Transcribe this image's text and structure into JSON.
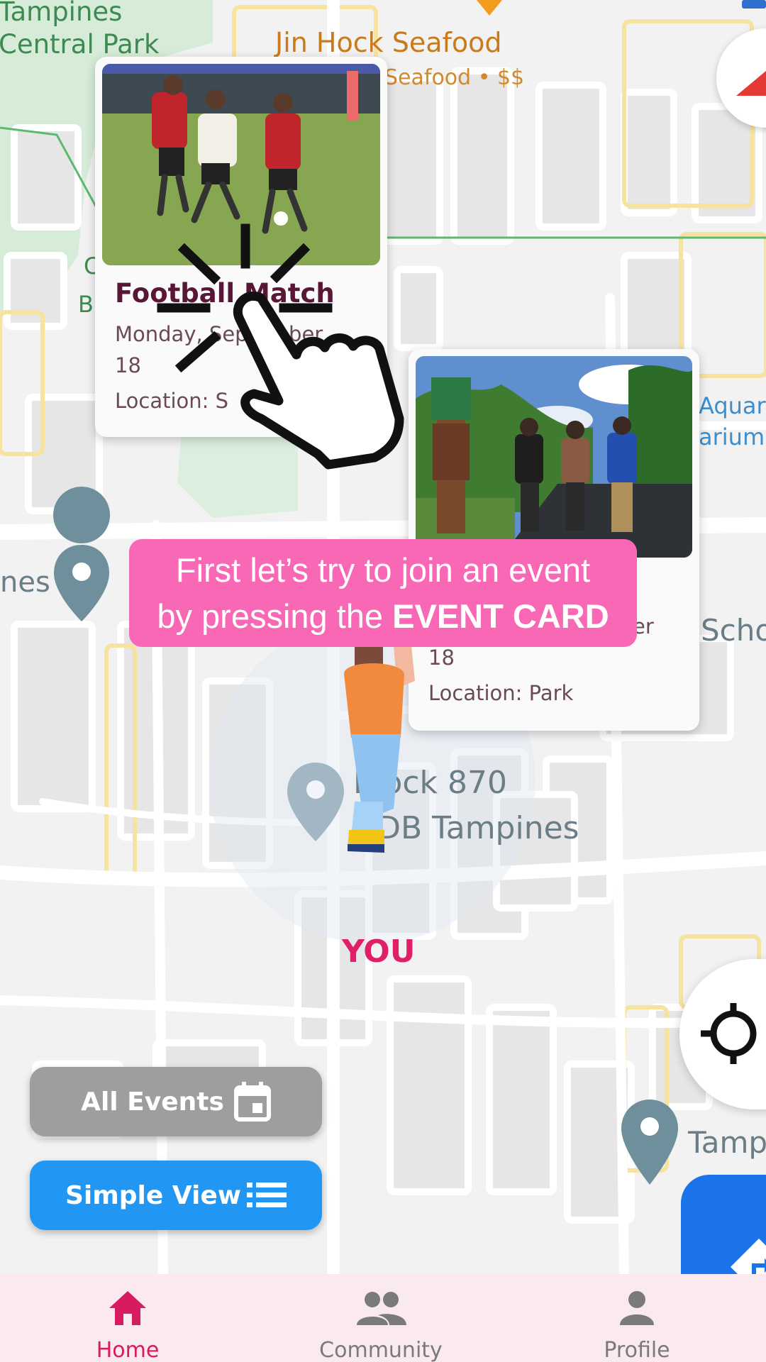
{
  "map": {
    "poi_tampines_park": "Tampines\nCentral Park",
    "poi_restaurant": "Jin Hock Seafood",
    "poi_restaurant_sub": "Seafood • $$",
    "poi_block": "Block 870\nHDB Tampines",
    "poi_aquarium": "Aquar\narium",
    "poi_school": "Scho",
    "poi_left": "nes",
    "poi_right_bottom": "Tamp",
    "poi_b": "B",
    "poi_c": "C",
    "you_label": "YOU",
    "you_color": "#e01f68"
  },
  "events": [
    {
      "title": "Football Match",
      "date": "Monday, September",
      "day": "18",
      "location": "Location: S"
    },
    {
      "title": "",
      "date": "er",
      "day": "18",
      "location": "Location: Park"
    }
  ],
  "tutorial": {
    "line1": "First let’s try to join an event",
    "line2_prefix": "by pressing the ",
    "line2_bold": "EVENT CARD",
    "bg_color": "#f968b5"
  },
  "buttons": {
    "all_events": "All Events",
    "simple_view": "Simple View",
    "all_events_icon": "calendar-icon",
    "simple_view_icon": "list-icon",
    "simple_view_color": "#2196f3",
    "all_events_color": "#9e9e9e"
  },
  "nav": {
    "items": [
      {
        "label": "Home",
        "icon": "home-icon",
        "active": true
      },
      {
        "label": "Community",
        "icon": "people-icon",
        "active": false
      },
      {
        "label": "Profile",
        "icon": "person-icon",
        "active": false
      }
    ],
    "active_color": "#d81b60",
    "inactive_color": "#7a7a7a"
  }
}
